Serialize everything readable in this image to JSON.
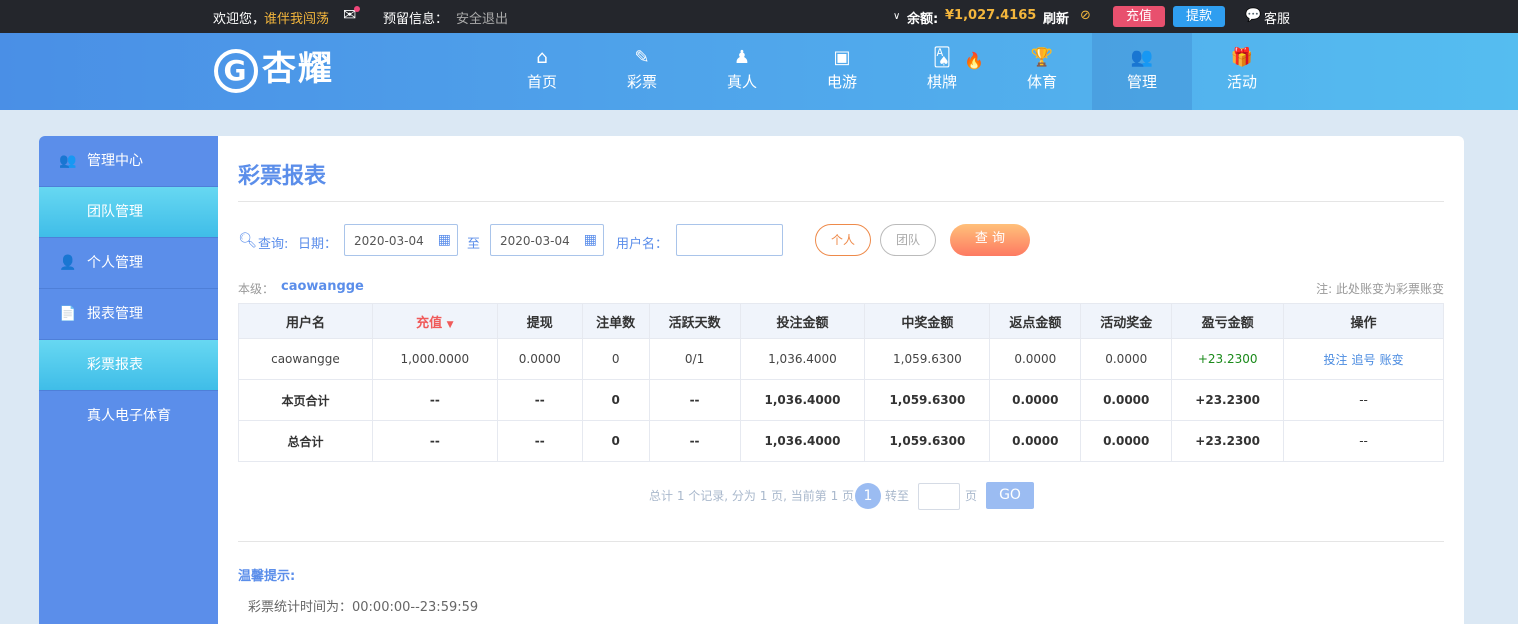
{
  "topbar": {
    "welcome": "欢迎您，",
    "username": "谁伴我闯荡",
    "reserve_label": "预留信息：",
    "logout": "安全退出",
    "balance_label": "余额:",
    "balance": "¥1,027.4165",
    "refresh": "刷新",
    "deposit": "充值",
    "withdraw": "提款",
    "service": "客服"
  },
  "nav": {
    "logo": "杏耀",
    "items": [
      {
        "label": "首页",
        "icon": "⌂"
      },
      {
        "label": "彩票",
        "icon": "✎"
      },
      {
        "label": "真人",
        "icon": "♟"
      },
      {
        "label": "电游",
        "icon": "▣"
      },
      {
        "label": "棋牌",
        "icon": "🂡"
      },
      {
        "label": "体育",
        "icon": "🏆"
      },
      {
        "label": "管理",
        "icon": "👥"
      },
      {
        "label": "活动",
        "icon": "🎁"
      }
    ]
  },
  "sidebar": {
    "items": [
      {
        "label": "管理中心",
        "icon": "👥"
      },
      {
        "label": "团队管理"
      },
      {
        "label": "个人管理",
        "icon": "👤"
      },
      {
        "label": "报表管理",
        "icon": "📄"
      },
      {
        "label": "彩票报表"
      },
      {
        "label": "真人电子体育"
      }
    ]
  },
  "main": {
    "title": "彩票报表",
    "filters": {
      "query_label": "查询:",
      "date_label": "日期：",
      "date_from": "2020-03-04",
      "to": "至",
      "date_to": "2020-03-04",
      "user_label": "用户名：",
      "user_value": "",
      "personal": "个人",
      "team": "团队",
      "search": "查 询"
    },
    "level_label": "本级：",
    "level_user": "caowangge",
    "note": "注: 此处账变为彩票账变",
    "columns": [
      "用户名",
      "充值",
      "提现",
      "注单数",
      "活跃天数",
      "投注金额",
      "中奖金额",
      "返点金额",
      "活动奖金",
      "盈亏金额",
      "操作"
    ],
    "rows": [
      [
        "caowangge",
        "1,000.0000",
        "0.0000",
        "0",
        "0/1",
        "1,036.4000",
        "1,059.6300",
        "0.0000",
        "0.0000",
        "+23.2300"
      ],
      [
        "本页合计",
        "--",
        "--",
        "0",
        "--",
        "1,036.4000",
        "1,059.6300",
        "0.0000",
        "0.0000",
        "+23.2300",
        "--"
      ],
      [
        "总合计",
        "--",
        "--",
        "0",
        "--",
        "1,036.4000",
        "1,059.6300",
        "0.0000",
        "0.0000",
        "+23.2300",
        "--"
      ]
    ],
    "ops": [
      "投注",
      "追号",
      "账变"
    ],
    "pagination": {
      "summary": "总计 1 个记录, 分为 1 页, 当前第 1 页",
      "current": "1",
      "goto": "转至",
      "page": "页",
      "go": "GO"
    },
    "tips_title": "温馨提示:",
    "tips": "彩票统计时间为：00:00:00--23:59:59"
  }
}
